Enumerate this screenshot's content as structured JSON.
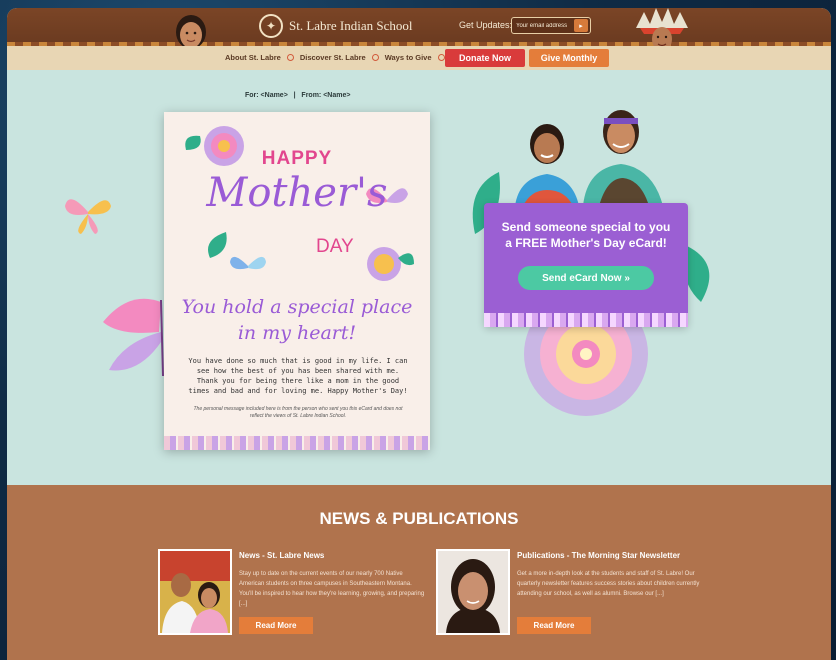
{
  "header": {
    "logo_text": "St. Labre Indian School",
    "updates_label": "Get Updates:",
    "email_placeholder": "Your email address",
    "submit_glyph": "▸"
  },
  "nav": {
    "items": [
      {
        "label": "About St. Labre"
      },
      {
        "label": "Discover St. Labre"
      },
      {
        "label": "Ways to Give"
      }
    ],
    "donate_label": "Donate Now",
    "monthly_label": "Give Monthly"
  },
  "ecard": {
    "from_to": "For: <Name>   |   From: <Name>",
    "happy": "HAPPY",
    "mothers": "Mother's",
    "day": "DAY",
    "headline_line1": "You hold a special place",
    "headline_line2": "in my heart!",
    "message": "You have done so much that is good in my life. I can see how the best of you has been shared with me. Thank you for being there like a mom in the good times and bad and for loving me. Happy Mother's Day!",
    "disclaimer": "The personal message included here is from the person who sent you this eCard and does not reflect the views of St. Labre Indian School."
  },
  "promo": {
    "line1": "Send someone special to you",
    "line2": "a FREE Mother's Day eCard!",
    "button_label": "Send eCard Now »"
  },
  "news": {
    "title": "NEWS & PUBLICATIONS",
    "items": [
      {
        "heading": "News - St. Labre News",
        "description": "Stay up to date on the current events of our nearly 700 Native American students on three campuses in Southeastern Montana. You'll be inspired to hear how they're learning, growing, and preparing [...]",
        "button_label": "Read More"
      },
      {
        "heading": "Publications - The Morning Star Newsletter",
        "description": "Get a more in-depth look at the students and staff of St. Labre! Our quarterly newsletter features success stories about children currently attending our school, as well as alumni. Browse our [...]",
        "button_label": "Read More"
      }
    ]
  },
  "colors": {
    "header_brown": "#7b4526",
    "teal_bg": "#c9e4df",
    "donate_red": "#d93b3b",
    "accent_orange": "#e47d3a",
    "promo_purple": "#9b5fd3",
    "promo_button_green": "#4cc9a3",
    "news_bg": "#b0734d"
  }
}
